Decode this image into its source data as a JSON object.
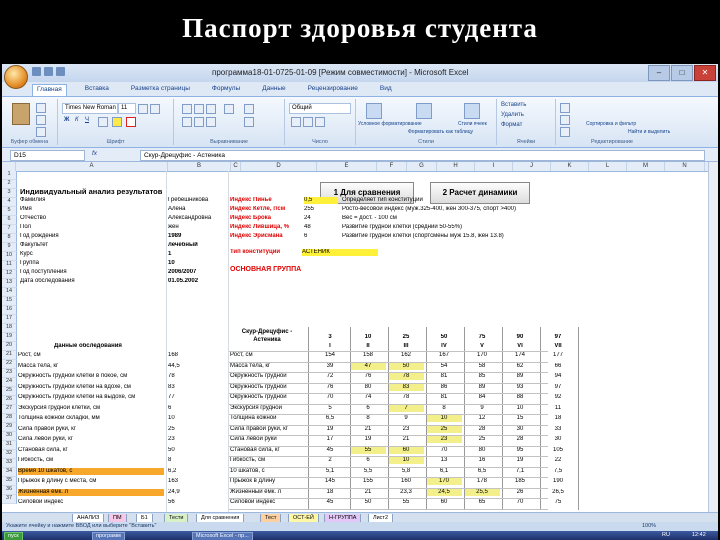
{
  "slide": {
    "title": "Паспорт здоровья студента"
  },
  "window": {
    "title": "программа18-01-0725-01-09 [Режим совместимости] - Microsoft Excel"
  },
  "tabs": [
    "Главная",
    "Вставка",
    "Разметка страницы",
    "Формулы",
    "Данные",
    "Рецензирование",
    "Вид"
  ],
  "ribbon": {
    "font_name": "Times New Roman",
    "font_size": "11",
    "number_format": "Общий",
    "groups": [
      "Буфер обмена",
      "Шрифт",
      "Выравнивание",
      "Число",
      "Стили",
      "Ячейки",
      "Редактирование"
    ],
    "styles": [
      "Условное форматирование",
      "Форматировать как таблицу",
      "Стили ячеек"
    ],
    "cells": [
      "Вставить",
      "Удалить",
      "Формат"
    ],
    "editing": [
      "Сортировка и фильтр",
      "Найти и выделить"
    ]
  },
  "formula_bar": {
    "name_box": "D15",
    "fx": "fx",
    "formula": "Скур-Дрецуфис - Астеника"
  },
  "columns": [
    "A",
    "B",
    "C",
    "D",
    "E",
    "F",
    "G",
    "H",
    "I",
    "J",
    "K",
    "L",
    "M",
    "N"
  ],
  "rows": [
    "1",
    "2",
    "3",
    "4",
    "5",
    "6",
    "7",
    "8",
    "9",
    "10",
    "11",
    "12",
    "13",
    "14",
    "15",
    "16",
    "17",
    "18",
    "19",
    "20",
    "21",
    "22",
    "23",
    "24",
    "25",
    "26",
    "27",
    "28",
    "29",
    "30",
    "31",
    "32",
    "33",
    "34",
    "35",
    "36",
    "37"
  ],
  "header": {
    "title": "Индивидуальный анализ результатов",
    "btn1": "1 Для сравнения",
    "btn2": "2 Расчет динамики"
  },
  "personal": [
    {
      "label": "Фамилия",
      "value": "Гребешникова"
    },
    {
      "label": "Имя",
      "value": "Алена"
    },
    {
      "label": "Отчество",
      "value": "Александровна"
    },
    {
      "label": "Пол",
      "value": "жен"
    },
    {
      "label": "Год рождения",
      "value": "1989"
    },
    {
      "label": "Факультет",
      "value": "лечебный"
    },
    {
      "label": "Курс",
      "value": "1"
    },
    {
      "label": "Группа",
      "value": "10"
    },
    {
      "label": "Год поступления",
      "value": "2006/2007"
    },
    {
      "label": "Дата обследования",
      "value": "01.05.2002"
    }
  ],
  "indices": [
    {
      "label": "Индекс Пинье",
      "value": "0,5",
      "desc": "Определяет тип конституции"
    },
    {
      "label": "Индекс Кетле, г/см",
      "value": "255",
      "desc": "Росто-весовой индекс (муж.325-400, жен 300-375, спорт >400)"
    },
    {
      "label": "Индекс Брока",
      "value": "24",
      "desc": "Вес = дост. - 100 см"
    },
    {
      "label": "Индекс Лившица, %",
      "value": "48",
      "desc": "Развитие грудной клетки (средний 50-55%)"
    },
    {
      "label": "Индекс Эрисмана",
      "value": "6",
      "desc": "Развитие грудной клетки (спортсмены муж 15.8, жен 13.8)"
    }
  ],
  "constitution": {
    "label": "Тип конституции",
    "value": "АСТЕНИК"
  },
  "group": {
    "label": "ОСНОВНАЯ ГРУППА"
  },
  "table": {
    "left_title": "Данные обследования",
    "mid_title": "Скур-Дрецуфис - Астеника",
    "percentiles": [
      "3",
      "10",
      "25",
      "50",
      "75",
      "90",
      "97"
    ],
    "roman": [
      "I",
      "II",
      "III",
      "IV",
      "V",
      "VI",
      "VII"
    ],
    "rows": [
      {
        "name": "Рост, см",
        "val": "168",
        "mid": "Рост, см",
        "p": [
          "154",
          "158",
          "162",
          "167",
          "170",
          "174",
          "177"
        ]
      },
      {
        "name": "Масса тела, кг",
        "val": "44,5",
        "mid": "Масса тела, кг",
        "p": [
          "39",
          "47",
          "50",
          "54",
          "58",
          "62",
          "66"
        ]
      },
      {
        "name": "Окружность грудной клетки в покое, см",
        "val": "78",
        "mid": "Окружность грудной",
        "p": [
          "72",
          "76",
          "78",
          "81",
          "85",
          "89",
          "94"
        ]
      },
      {
        "name": "Окружность грудной клетки на вдохе, см",
        "val": "83",
        "mid": "Окружность грудной",
        "p": [
          "76",
          "80",
          "83",
          "86",
          "89",
          "93",
          "97"
        ]
      },
      {
        "name": "Окружность грудной клетки на выдохе, см",
        "val": "77",
        "mid": "Окружность грудной",
        "p": [
          "70",
          "74",
          "78",
          "81",
          "84",
          "88",
          "92"
        ]
      },
      {
        "name": "Экскурсия грудной клетки, см",
        "val": "6",
        "mid": "Экскурсия грудной",
        "p": [
          "5",
          "6",
          "7",
          "8",
          "9",
          "10",
          "11"
        ]
      },
      {
        "name": "Толщина кожной складки, мм",
        "val": "10",
        "mid": "Толщина кожной",
        "p": [
          "6,5",
          "8",
          "9",
          "10",
          "12",
          "15",
          "18"
        ]
      },
      {
        "name": "Сила правой руки, кг",
        "val": "25",
        "mid": "Сила правой руки, кг",
        "p": [
          "19",
          "21",
          "23",
          "25",
          "28",
          "30",
          "33"
        ]
      },
      {
        "name": "Сила левой руки, кг",
        "val": "23",
        "mid": "Сила левой руки",
        "p": [
          "17",
          "19",
          "21",
          "23",
          "25",
          "28",
          "30"
        ]
      },
      {
        "name": "Становая сила, кг",
        "val": "50",
        "mid": "Становая сила, кг",
        "p": [
          "45",
          "55",
          "60",
          "70",
          "80",
          "95",
          "105"
        ]
      },
      {
        "name": "Гибкость, см",
        "val": "8",
        "mid": "Гибкость, см",
        "p": [
          "2",
          "6",
          "10",
          "13",
          "16",
          "19",
          "22"
        ]
      },
      {
        "name": "Время 10 шкатов, с",
        "val": "6,2",
        "mid": "10 шкатов, с",
        "p": [
          "5,1",
          "5,5",
          "5,8",
          "6,1",
          "6,5",
          "7,1",
          "7,5"
        ]
      },
      {
        "name": "Прыжок в длину с места, см",
        "val": "163",
        "mid": "Прыжок в длину",
        "p": [
          "145",
          "155",
          "160",
          "170",
          "178",
          "185",
          "190"
        ]
      },
      {
        "name": "Жизненная ёмк. л",
        "val": "24,9",
        "mid": "Жизненный ёмк. л",
        "p": [
          "18",
          "21",
          "23,3",
          "24,5",
          "25,5",
          "26",
          "26,5"
        ]
      },
      {
        "name": "Силовой индекс",
        "val": "56",
        "mid": "Силовой индекс",
        "p": [
          "45",
          "50",
          "55",
          "60",
          "65",
          "70",
          "75"
        ]
      }
    ]
  },
  "sheets": [
    "АНАЛИЗ",
    "ПМ",
    "Б1",
    "Тести",
    "Для сравнения",
    "Тест",
    "ОСТ-ЕЙ",
    "Н-ГРУППА",
    "Лист2"
  ],
  "status": {
    "left": "Укажите ячейку и нажмите ВВОД или выберите \"Вставить\"",
    "zoom": "100%"
  },
  "taskbar": {
    "start": "пуск",
    "items": [
      "программ",
      "Microsoft Excel - пр..."
    ],
    "lang": "RU",
    "clock": "12:42"
  }
}
